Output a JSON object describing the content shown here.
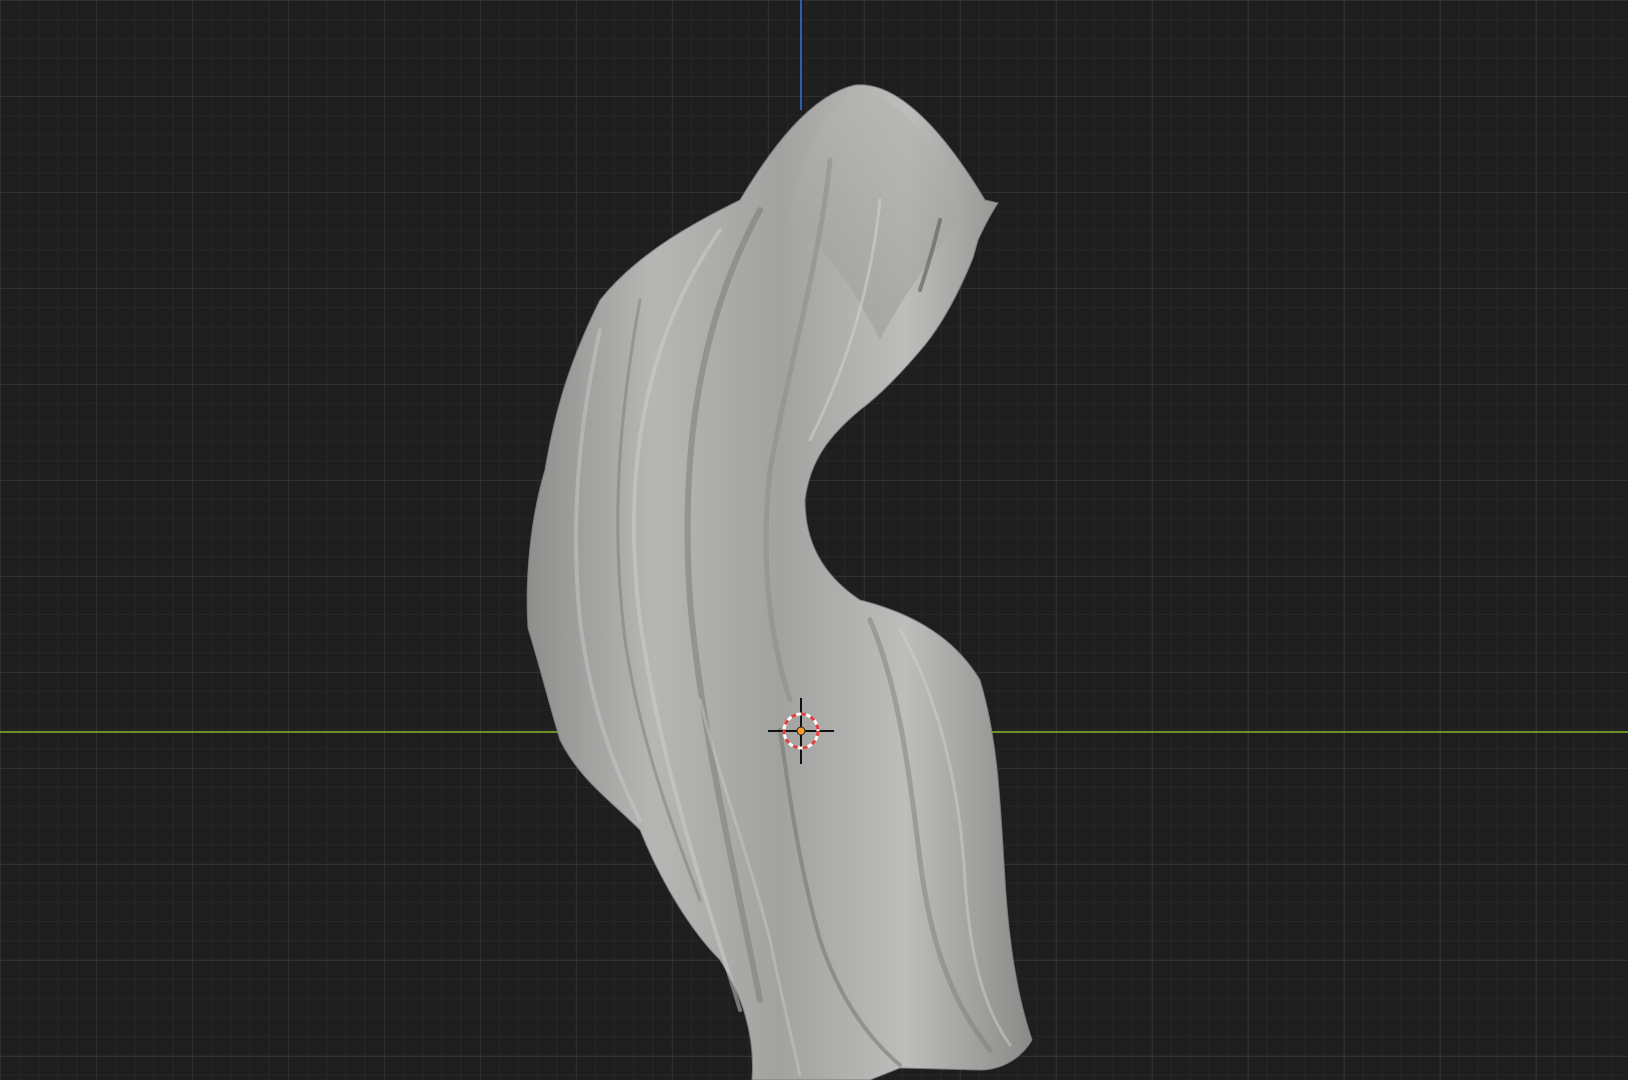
{
  "viewport": {
    "background_color": "#1e1e1e",
    "grid_major_color": "#303030",
    "grid_minor_color": "#272727",
    "axis_x_color": "#6f8f27",
    "axis_z_color": "#2f5fa8"
  },
  "object": {
    "type": "cloth-mesh",
    "shade_color": "#9a9a98",
    "highlight_color": "#c8c8c6",
    "shadow_color": "#6e6e6c"
  },
  "cursor_3d": {
    "icon": "3d-cursor-icon",
    "ring_color_a": "#e04040",
    "ring_color_b": "#ffffff"
  },
  "origin": {
    "icon": "object-origin-icon",
    "color": "#ff9a2a"
  }
}
